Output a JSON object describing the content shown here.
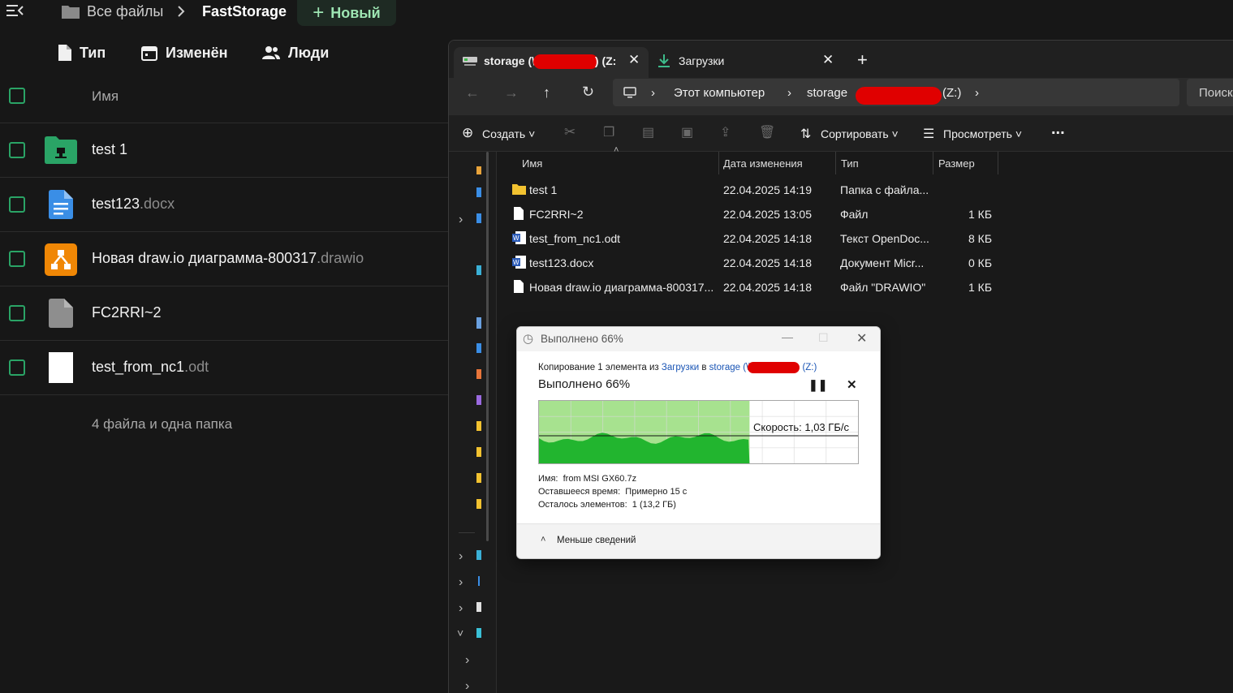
{
  "nextcloud": {
    "breadcrumb": {
      "all_files": "Все файлы",
      "current": "FastStorage"
    },
    "new_button": "Новый",
    "filters": {
      "type": "Тип",
      "modified": "Изменён",
      "people": "Люди"
    },
    "header_name": "Имя",
    "files": [
      {
        "name": "test 1",
        "ext": "",
        "icon": "folder-icon"
      },
      {
        "name": "test123",
        "ext": ".docx",
        "icon": "document-icon"
      },
      {
        "name": "Новая draw.io диаграмма-800317",
        "ext": ".drawio",
        "icon": "drawio-icon"
      },
      {
        "name": "FC2RRI~2",
        "ext": "",
        "icon": "file-icon"
      },
      {
        "name": "test_from_nc1",
        "ext": ".odt",
        "icon": "odt-icon"
      }
    ],
    "summary": "4 файла и одна папка"
  },
  "explorer": {
    "tabs": [
      {
        "label_pre": "storage (\\\\",
        "label_post": ") (Z:"
      },
      {
        "label": "Загрузки"
      }
    ],
    "address": {
      "computer": "Этот компьютер",
      "storage": "storage",
      "drive": "(Z:)"
    },
    "search_placeholder": "Поиск",
    "commands": {
      "create": "Создать",
      "sort": "Сортировать",
      "view": "Просмотреть",
      "more": "..."
    },
    "columns": {
      "name": "Имя",
      "modified": "Дата изменения",
      "type": "Тип",
      "size": "Размер"
    },
    "files": [
      {
        "name": "test 1",
        "modified": "22.04.2025 14:19",
        "type": "Папка с файла...",
        "size": "",
        "icon": "folder-icon"
      },
      {
        "name": "FC2RRI~2",
        "modified": "22.04.2025 13:05",
        "type": "Файл",
        "size": "1 КБ",
        "icon": "file-icon"
      },
      {
        "name": "test_from_nc1.odt",
        "modified": "22.04.2025 14:18",
        "type": "Текст OpenDoc...",
        "size": "8 КБ",
        "icon": "word-icon"
      },
      {
        "name": "test123.docx",
        "modified": "22.04.2025 14:18",
        "type": "Документ Micr...",
        "size": "0 КБ",
        "icon": "word-icon"
      },
      {
        "name": "Новая draw.io диаграмма-800317...",
        "modified": "22.04.2025 14:18",
        "type": "Файл \"DRAWIO\"",
        "size": "1 КБ",
        "icon": "file-icon"
      }
    ]
  },
  "copy_dialog": {
    "title": "Выполнено 66%",
    "progress_percent": 66,
    "desc_prefix": "Копирование 1 элемента из",
    "source": "Загрузки",
    "desc_mid": "в",
    "dest_pre": "storage (\\\\",
    "dest_post": "(Z:)",
    "status": "Выполнено 66%",
    "speed": "Скорость: 1,03 ГБ/с",
    "details": [
      {
        "label": "Имя:",
        "value": "from MSI GX60.7z"
      },
      {
        "label": "Оставшееся время:",
        "value": "Примерно 15 с"
      },
      {
        "label": "Осталось элементов:",
        "value": "1 (13,2 ГБ)"
      }
    ],
    "less_details": "Меньше сведений"
  }
}
